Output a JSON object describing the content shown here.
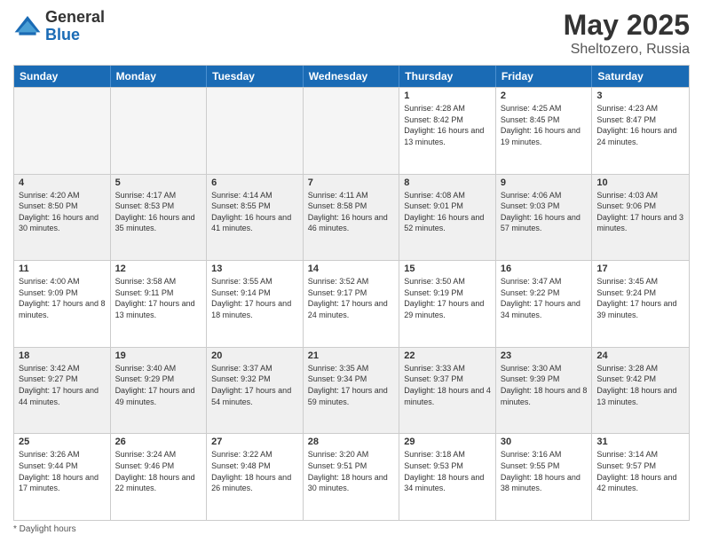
{
  "logo": {
    "general": "General",
    "blue": "Blue"
  },
  "title": "May 2025",
  "location": "Sheltozero, Russia",
  "days": [
    "Sunday",
    "Monday",
    "Tuesday",
    "Wednesday",
    "Thursday",
    "Friday",
    "Saturday"
  ],
  "footer": "Daylight hours",
  "weeks": [
    [
      {
        "day": "",
        "empty": true
      },
      {
        "day": "",
        "empty": true
      },
      {
        "day": "",
        "empty": true
      },
      {
        "day": "",
        "empty": true
      },
      {
        "day": "1",
        "sunrise": "4:28 AM",
        "sunset": "8:42 PM",
        "daylight": "16 hours and 13 minutes."
      },
      {
        "day": "2",
        "sunrise": "4:25 AM",
        "sunset": "8:45 PM",
        "daylight": "16 hours and 19 minutes."
      },
      {
        "day": "3",
        "sunrise": "4:23 AM",
        "sunset": "8:47 PM",
        "daylight": "16 hours and 24 minutes."
      }
    ],
    [
      {
        "day": "4",
        "sunrise": "4:20 AM",
        "sunset": "8:50 PM",
        "daylight": "16 hours and 30 minutes."
      },
      {
        "day": "5",
        "sunrise": "4:17 AM",
        "sunset": "8:53 PM",
        "daylight": "16 hours and 35 minutes."
      },
      {
        "day": "6",
        "sunrise": "4:14 AM",
        "sunset": "8:55 PM",
        "daylight": "16 hours and 41 minutes."
      },
      {
        "day": "7",
        "sunrise": "4:11 AM",
        "sunset": "8:58 PM",
        "daylight": "16 hours and 46 minutes."
      },
      {
        "day": "8",
        "sunrise": "4:08 AM",
        "sunset": "9:01 PM",
        "daylight": "16 hours and 52 minutes."
      },
      {
        "day": "9",
        "sunrise": "4:06 AM",
        "sunset": "9:03 PM",
        "daylight": "16 hours and 57 minutes."
      },
      {
        "day": "10",
        "sunrise": "4:03 AM",
        "sunset": "9:06 PM",
        "daylight": "17 hours and 3 minutes."
      }
    ],
    [
      {
        "day": "11",
        "sunrise": "4:00 AM",
        "sunset": "9:09 PM",
        "daylight": "17 hours and 8 minutes."
      },
      {
        "day": "12",
        "sunrise": "3:58 AM",
        "sunset": "9:11 PM",
        "daylight": "17 hours and 13 minutes."
      },
      {
        "day": "13",
        "sunrise": "3:55 AM",
        "sunset": "9:14 PM",
        "daylight": "17 hours and 18 minutes."
      },
      {
        "day": "14",
        "sunrise": "3:52 AM",
        "sunset": "9:17 PM",
        "daylight": "17 hours and 24 minutes."
      },
      {
        "day": "15",
        "sunrise": "3:50 AM",
        "sunset": "9:19 PM",
        "daylight": "17 hours and 29 minutes."
      },
      {
        "day": "16",
        "sunrise": "3:47 AM",
        "sunset": "9:22 PM",
        "daylight": "17 hours and 34 minutes."
      },
      {
        "day": "17",
        "sunrise": "3:45 AM",
        "sunset": "9:24 PM",
        "daylight": "17 hours and 39 minutes."
      }
    ],
    [
      {
        "day": "18",
        "sunrise": "3:42 AM",
        "sunset": "9:27 PM",
        "daylight": "17 hours and 44 minutes."
      },
      {
        "day": "19",
        "sunrise": "3:40 AM",
        "sunset": "9:29 PM",
        "daylight": "17 hours and 49 minutes."
      },
      {
        "day": "20",
        "sunrise": "3:37 AM",
        "sunset": "9:32 PM",
        "daylight": "17 hours and 54 minutes."
      },
      {
        "day": "21",
        "sunrise": "3:35 AM",
        "sunset": "9:34 PM",
        "daylight": "17 hours and 59 minutes."
      },
      {
        "day": "22",
        "sunrise": "3:33 AM",
        "sunset": "9:37 PM",
        "daylight": "18 hours and 4 minutes."
      },
      {
        "day": "23",
        "sunrise": "3:30 AM",
        "sunset": "9:39 PM",
        "daylight": "18 hours and 8 minutes."
      },
      {
        "day": "24",
        "sunrise": "3:28 AM",
        "sunset": "9:42 PM",
        "daylight": "18 hours and 13 minutes."
      }
    ],
    [
      {
        "day": "25",
        "sunrise": "3:26 AM",
        "sunset": "9:44 PM",
        "daylight": "18 hours and 17 minutes."
      },
      {
        "day": "26",
        "sunrise": "3:24 AM",
        "sunset": "9:46 PM",
        "daylight": "18 hours and 22 minutes."
      },
      {
        "day": "27",
        "sunrise": "3:22 AM",
        "sunset": "9:48 PM",
        "daylight": "18 hours and 26 minutes."
      },
      {
        "day": "28",
        "sunrise": "3:20 AM",
        "sunset": "9:51 PM",
        "daylight": "18 hours and 30 minutes."
      },
      {
        "day": "29",
        "sunrise": "3:18 AM",
        "sunset": "9:53 PM",
        "daylight": "18 hours and 34 minutes."
      },
      {
        "day": "30",
        "sunrise": "3:16 AM",
        "sunset": "9:55 PM",
        "daylight": "18 hours and 38 minutes."
      },
      {
        "day": "31",
        "sunrise": "3:14 AM",
        "sunset": "9:57 PM",
        "daylight": "18 hours and 42 minutes."
      }
    ]
  ]
}
